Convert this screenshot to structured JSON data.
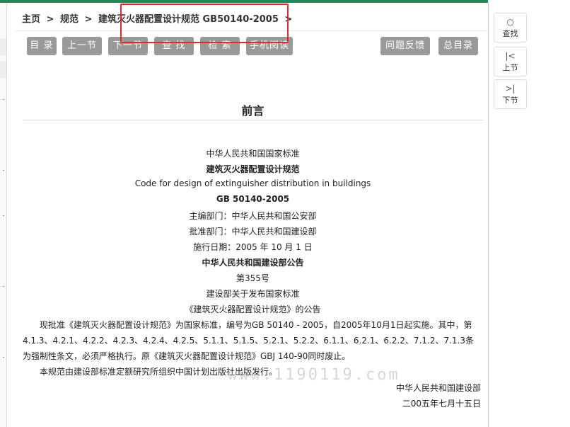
{
  "breadcrumb": {
    "home": "主页",
    "sep1": ">",
    "category": "规范",
    "sep2": ">",
    "current": "建筑灭火器配置设计规范 GB50140-2005",
    "sep3": ">"
  },
  "toolbar": {
    "toc": "目 录",
    "prev": "上一节",
    "next": "下一节",
    "find": "查 找",
    "search": "检 索",
    "mobile": "手机阅读",
    "feedback": "问题反馈",
    "catalog": "总目录"
  },
  "content": {
    "title": "前言",
    "line1": "中华人民共和国国家标准",
    "line2": "建筑灭火器配置设计规范",
    "line3": "Code for design of extinguisher distribution in buildings",
    "line4": "GB 50140-2005",
    "line5": "主编部门：中华人民共和国公安部",
    "line6": "批准部门：中华人民共和国建设部",
    "line7": "施行日期：2005 年 10 月 1 日",
    "line8": "中华人民共和国建设部公告",
    "line9": "第355号",
    "line10": "建设部关于发布国家标准",
    "line11": "《建筑灭火器配置设计规范》的公告",
    "para1": "现批准《建筑灭火器配置设计规范》为国家标准，编号为GB 50140 - 2005，自2005年10月1日起实施。其中，第4.1.3、4.2.1、4.2.2、4.2.3、4.2.4、4.2.5、5.1.1、5.1.5、5.2.1、5.2.2、6.1.1、6.2.1、6.2.2、7.1.2、7.1.3条为强制性条文，必须严格执行。原《建筑灭火器配置设计规范》GBJ 140-90同时废止。",
    "para2": "本规范由建设部标准定额研究所组织中国计划出版社出版发行。",
    "sign1": "中华人民共和国建设部",
    "sign2": "二00五年七月十五日"
  },
  "watermark": "www.1190119.com",
  "side": {
    "find": "查找",
    "prev": "上节",
    "next": "下节",
    "find_icon": "search-icon",
    "prev_icon": "skip-back-icon",
    "next_icon": "skip-forward-icon"
  },
  "colors": {
    "accent": "#1e8a55",
    "button": "#999999",
    "highlight": "#e02b2b"
  }
}
